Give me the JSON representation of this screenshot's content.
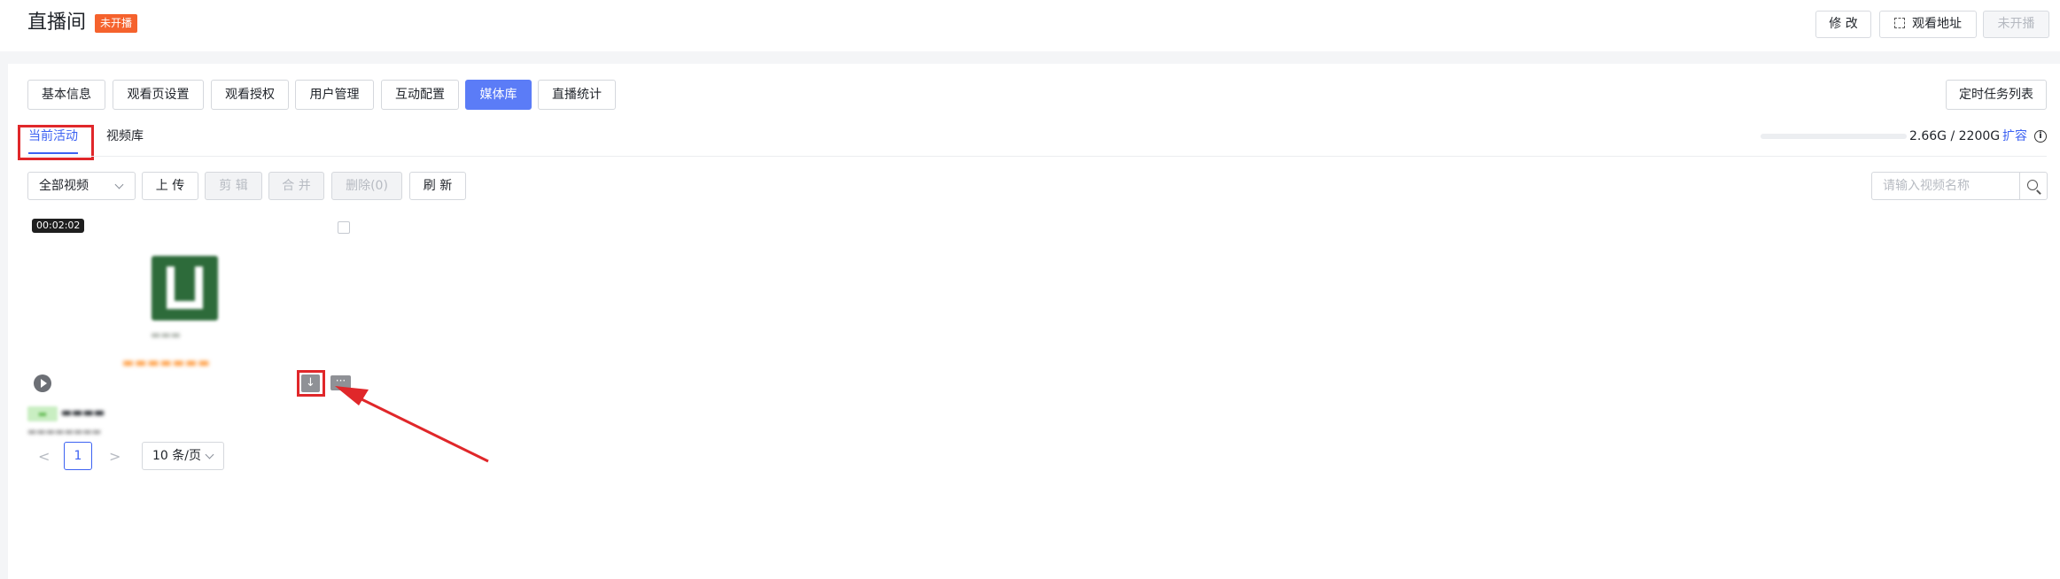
{
  "header": {
    "title": "直播间",
    "status_badge": "未开播",
    "edit_label": "修 改",
    "watch_url_label": "观看地址",
    "start_live_label": "未开播"
  },
  "nav_tabs": [
    {
      "label": "基本信息",
      "active": false
    },
    {
      "label": "观看页设置",
      "active": false
    },
    {
      "label": "观看授权",
      "active": false
    },
    {
      "label": "用户管理",
      "active": false
    },
    {
      "label": "互动配置",
      "active": false
    },
    {
      "label": "媒体库",
      "active": true
    },
    {
      "label": "直播统计",
      "active": false
    }
  ],
  "scheduled_tasks_label": "定时任务列表",
  "sub_tabs": [
    {
      "label": "当前活动",
      "active": true
    },
    {
      "label": "视频库",
      "active": false
    }
  ],
  "storage": {
    "text": "2.66G / 2200G",
    "used_fraction": 0.0012,
    "expand_label": "扩容",
    "info_icon": "i"
  },
  "toolbar": {
    "filter_value": "全部视频",
    "upload_label": "上 传",
    "clip_label": "剪 辑",
    "merge_label": "合 并",
    "delete_label": "删除(0)",
    "refresh_label": "刷 新",
    "search_placeholder": "请输入视频名称"
  },
  "video_card": {
    "duration": "00:02:02",
    "download_glyph": "↓",
    "more_glyph": "···"
  },
  "pagination": {
    "prev": "<",
    "current_page": "1",
    "next": ">",
    "page_size": "10 条/页"
  },
  "colors": {
    "accent": "#3c62f2",
    "active_tab": "#5b7cf7",
    "badge": "#f5622d",
    "highlight": "#e0272a"
  }
}
